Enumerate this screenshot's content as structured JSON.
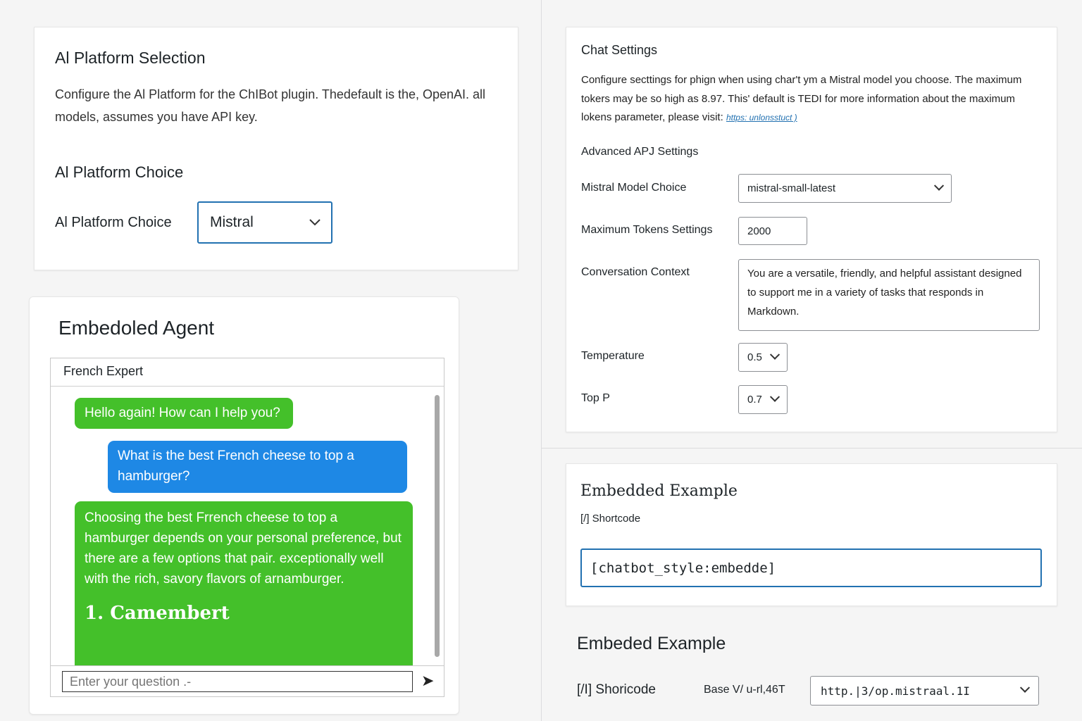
{
  "platform_section": {
    "title": "Al Platform Selection",
    "description": "Configure the Al Platform for the ChIBot plugin. Thedefault is the, OpenAI. all models, assumes you have API key.",
    "choice_heading": "Al Platform Choice",
    "choice_label": "Al Platform Choice",
    "choice_value": "Mistral"
  },
  "agent": {
    "title": "Embedoled Agent",
    "bot_name": "French Expert",
    "messages": [
      {
        "role": "bot",
        "text": "Hello again! How can I help you?"
      },
      {
        "role": "user",
        "text": "What is the best French cheese to top a hamburger?"
      },
      {
        "role": "bot",
        "text": "Choosing the best Frrench cheese to top a hamburger depends on your personal preference, but there are a few options that pair. exceptionally well with the rich, savory flavors of arnamburger.",
        "heading": "1. Camembert"
      }
    ],
    "input_placeholder": "Enter your question .-",
    "send_icon": "send-arrow-icon"
  },
  "chat_settings": {
    "title": "Chat Settings",
    "description": "Configure secttings for phign when using char't ym a Mistral model you choose. The maximum tokers may be so high as 8.97. This' default is TEDI for more information about the maximum lokens parameter, please visit:",
    "link_text": "https: unlonsstuct )",
    "advanced_heading": "Advanced APJ Settings",
    "model_label": "Mistral Model Choice",
    "model_value": "mistral-small-latest",
    "max_tokens_label": "Maximum Tokens Settings",
    "max_tokens_value": "2000",
    "context_label": "Conversation Context",
    "context_value": "You are a versatile, friendly, and helpful assistant designed to support me in a variety of tasks that responds in Markdown.",
    "temperature_label": "Temperature",
    "temperature_value": "0.5",
    "top_p_label": "Top P",
    "top_p_value": "0.7"
  },
  "embedded_example": {
    "title": "Embedded Example",
    "shortcode_label": "[/] Shortcode",
    "shortcode_value": "[chatbot_style:embedde]"
  },
  "embedded_example_2": {
    "title": "Embeded Example",
    "shortcode_label": "[/I] Shoricode",
    "base_label": "Base V/ u-rl,46T",
    "base_value": "http.|3/op.mistraal.1I"
  },
  "colors": {
    "accent": "#2271b1",
    "bot_bubble": "#44c02a",
    "user_bubble": "#1e88e5"
  }
}
